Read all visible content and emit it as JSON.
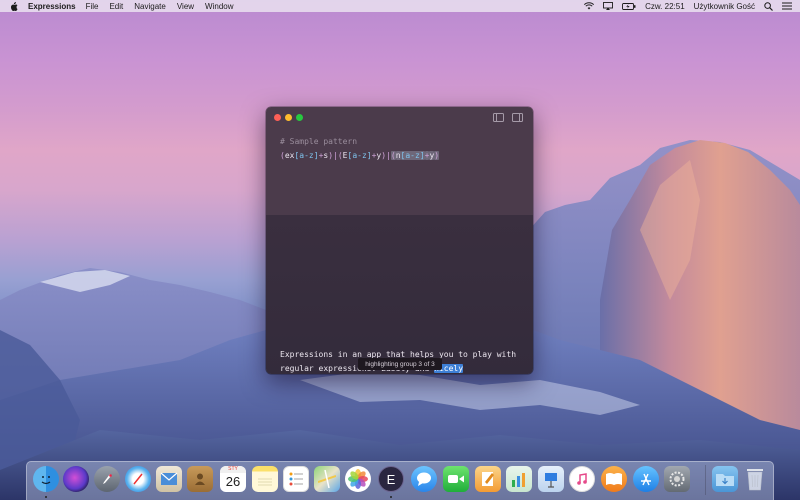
{
  "menubar": {
    "app_name": "Expressions",
    "menus": [
      "File",
      "Edit",
      "Navigate",
      "View",
      "Window"
    ],
    "clock": "Czw. 22:51",
    "user": "Użytkownik Gość",
    "status_icons": [
      "wifi-icon",
      "airplay-icon",
      "battery-icon",
      "search-icon",
      "list-icon"
    ]
  },
  "window": {
    "pattern_comment": "# Sample pattern",
    "regex_segments": [
      {
        "text": "(",
        "kind": "op"
      },
      {
        "text": "ex",
        "kind": "text"
      },
      {
        "text": "[a-z]",
        "kind": "cls"
      },
      {
        "text": "+",
        "kind": "op"
      },
      {
        "text": "s",
        "kind": "text"
      },
      {
        "text": ")|(",
        "kind": "op"
      },
      {
        "text": "E",
        "kind": "text"
      },
      {
        "text": "[a-z]",
        "kind": "cls"
      },
      {
        "text": "+",
        "kind": "op"
      },
      {
        "text": "y",
        "kind": "text"
      },
      {
        "text": ")|",
        "kind": "op"
      },
      {
        "text": "(",
        "kind": "op hl"
      },
      {
        "text": "n",
        "kind": "text hl"
      },
      {
        "text": "[a-z]",
        "kind": "cls hl"
      },
      {
        "text": "+",
        "kind": "op hl"
      },
      {
        "text": "y",
        "kind": "text hl"
      },
      {
        "text": ")",
        "kind": "op hl"
      }
    ],
    "sample_line1": "Expressions in an app that helps you to play with",
    "sample_line2_prefix": "regular expressions. Easily and ",
    "sample_match": "nicely",
    "status": "highlighting group 3 of 3"
  },
  "dock": {
    "calendar_month": "STY",
    "calendar_day": "26",
    "items": [
      "finder",
      "siri",
      "launchpad",
      "safari",
      "mail",
      "contacts",
      "calendar",
      "notes",
      "reminders",
      "maps",
      "photos",
      "expressions",
      "messages",
      "facetime",
      "pages",
      "numbers",
      "keynote",
      "itunes",
      "ibooks",
      "app-store",
      "system-preferences",
      "downloads",
      "trash"
    ]
  },
  "colors": {
    "window_top": "#4b3b4b",
    "window_bottom": "#3a2f3f",
    "match_highlight": "#3d7fd6",
    "regex_class": "#7fc4ee"
  }
}
